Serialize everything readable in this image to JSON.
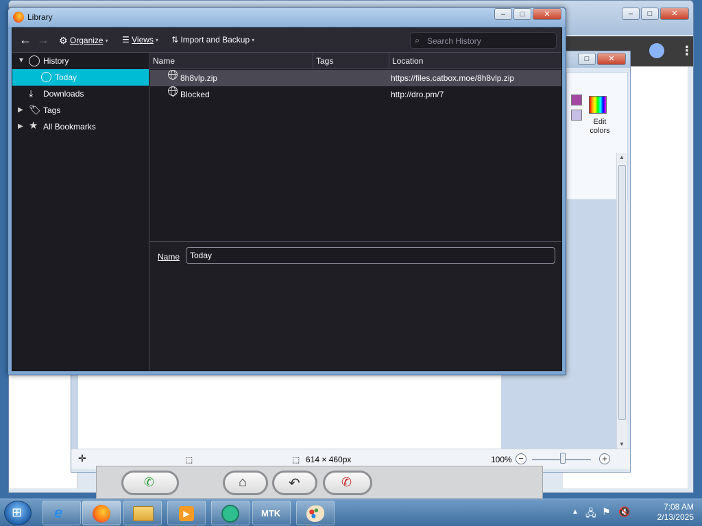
{
  "library": {
    "title": "Library",
    "toolbar": {
      "organize": "Organize",
      "views": "Views",
      "import_backup": "Import and Backup",
      "search_placeholder": "Search History"
    },
    "tree": [
      {
        "label": "History",
        "expanded": true
      },
      {
        "label": "Today",
        "selected": true
      },
      {
        "label": "Downloads"
      },
      {
        "label": "Tags",
        "expanded": false
      },
      {
        "label": "All Bookmarks",
        "expanded": false
      }
    ],
    "columns": {
      "name": "Name",
      "tags": "Tags",
      "location": "Location"
    },
    "rows": [
      {
        "name": "8h8vlp.zip",
        "tags": "",
        "location": "https://files.catbox.moe/8h8vlp.zip"
      },
      {
        "name": "Blocked",
        "tags": "",
        "location": "http://dro.pm/7"
      }
    ],
    "details": {
      "name_label": "Name",
      "name_value": "Today"
    }
  },
  "paint": {
    "edit_colors": "Edit colors",
    "dimensions": "614 × 460px",
    "zoom": "100%",
    "zoom_level": 1.0
  },
  "taskbar": {
    "items": [
      {
        "name": "internet-explorer"
      },
      {
        "name": "firefox",
        "active": true
      },
      {
        "name": "file-explorer"
      },
      {
        "name": "media-player"
      },
      {
        "name": "chat-app"
      },
      {
        "name": "MTK",
        "label": "MTK"
      },
      {
        "name": "paint"
      }
    ],
    "time": "7:08 AM",
    "date": "2/13/2025"
  },
  "colors": {
    "selection": "#00bcd4",
    "dark_bg": "#1c1b22",
    "toolbar_bg": "#2b2a33"
  }
}
